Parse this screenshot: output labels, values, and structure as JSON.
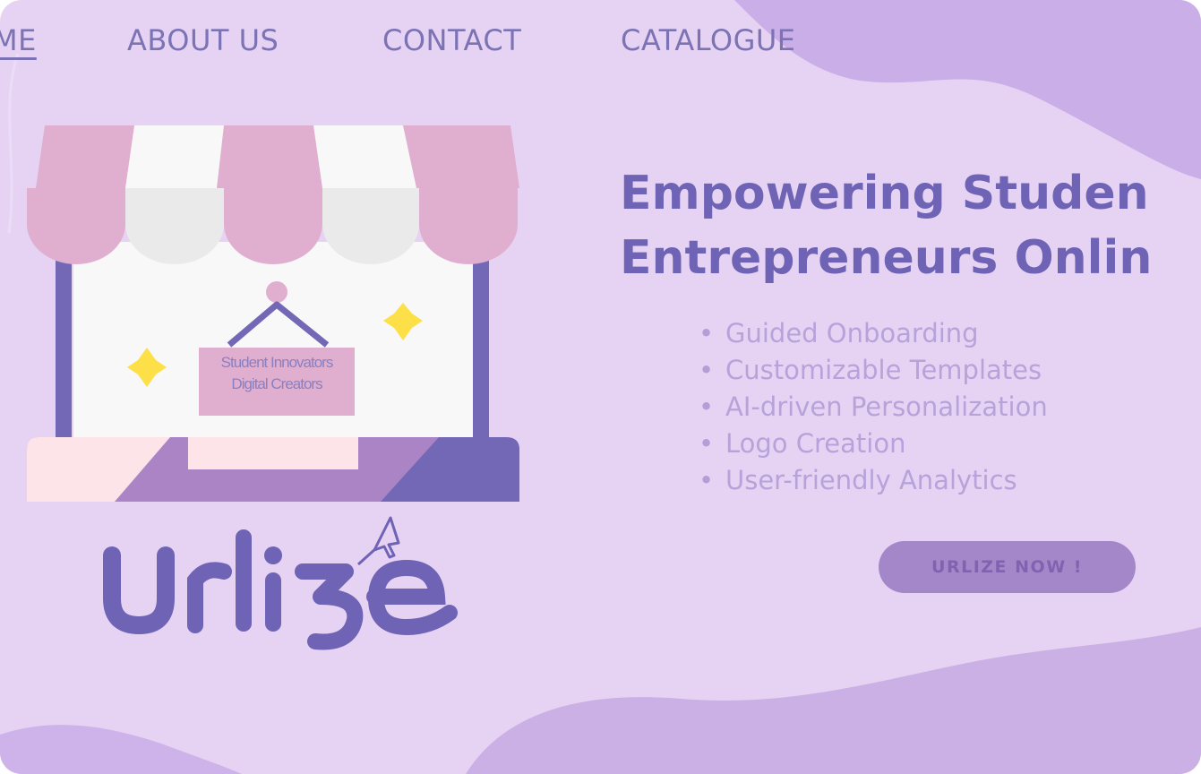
{
  "nav": {
    "home": "ME",
    "about": "ABOUT US",
    "contact": "CONTACT",
    "catalogue": "CATALOGUE"
  },
  "store": {
    "sign_line1": "Student Innovators",
    "sign_line2": "Digital Creators"
  },
  "logo": {
    "text": "Urlize"
  },
  "hero": {
    "headline_line1": "Empowering Studen",
    "headline_line2": "Entrepreneurs Onlin",
    "features": [
      "Guided Onboarding",
      "Customizable Templates",
      "AI-driven Personalization",
      "Logo Creation",
      "User-friendly Analytics"
    ],
    "cta_label": "URLIZE NOW !"
  },
  "colors": {
    "background": "#e6d3f4",
    "primary": "#6e63b4",
    "accent_pink": "#e0afd0",
    "button": "#a487c9",
    "sparkle": "#fde047"
  },
  "icons": {
    "sparkle": "sparkle-icon",
    "cursor": "cursor-arrow-icon"
  }
}
